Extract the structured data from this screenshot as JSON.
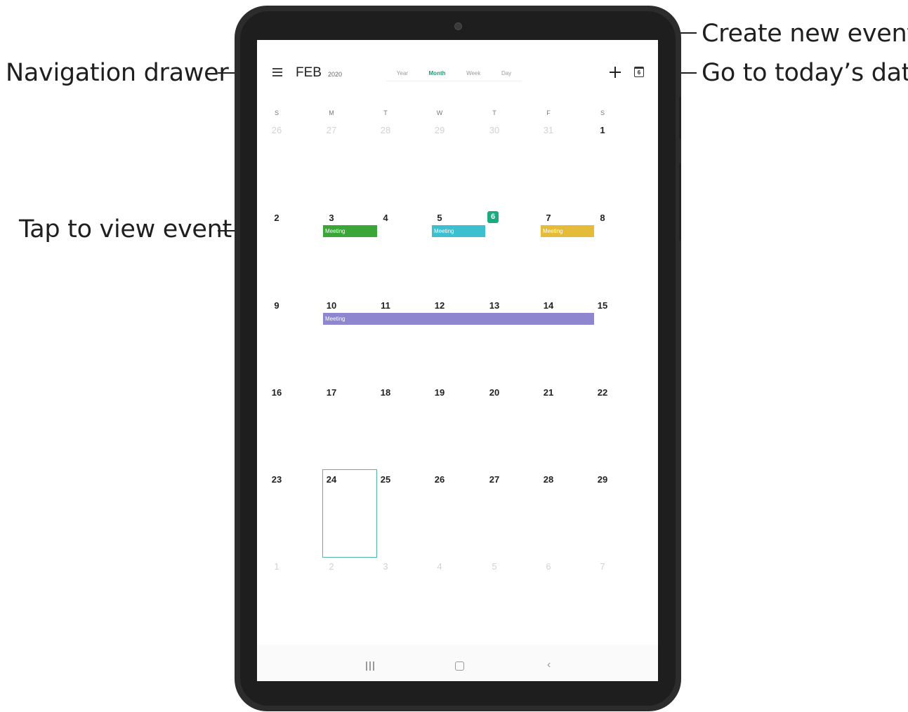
{
  "callouts": {
    "navigation_drawer": "Navigation drawer",
    "create_new_event": "Create new event",
    "go_to_today": "Go to today’s date",
    "tap_to_view_event": "Tap to view event"
  },
  "header": {
    "month": "FEB",
    "year": "2020",
    "view_tabs": [
      "Year",
      "Month",
      "Week",
      "Day"
    ],
    "active_view": "Month",
    "today_icon_day": "6"
  },
  "weekdays": [
    "S",
    "M",
    "T",
    "W",
    "T",
    "F",
    "S"
  ],
  "weeks": [
    [
      "26",
      "27",
      "28",
      "29",
      "30",
      "31",
      "1"
    ],
    [
      "2",
      "3",
      "4",
      "5",
      "6",
      "7",
      "8"
    ],
    [
      "9",
      "10",
      "11",
      "12",
      "13",
      "14",
      "15"
    ],
    [
      "16",
      "17",
      "18",
      "19",
      "20",
      "21",
      "22"
    ],
    [
      "23",
      "24",
      "25",
      "26",
      "27",
      "28",
      "29"
    ],
    [
      "1",
      "2",
      "3",
      "4",
      "5",
      "6",
      "7"
    ]
  ],
  "today": "6",
  "selected_day": "24",
  "events": [
    {
      "label": "Meeting",
      "color": "#3aa637"
    },
    {
      "label": "Meeting",
      "color": "#3cbfcf"
    },
    {
      "label": "Meeting",
      "color": "#e5bb3a"
    },
    {
      "label": "Meeting",
      "color": "#8e87cf"
    }
  ],
  "navbar": {
    "icons": [
      "recents-icon",
      "home-icon",
      "back-icon"
    ]
  }
}
